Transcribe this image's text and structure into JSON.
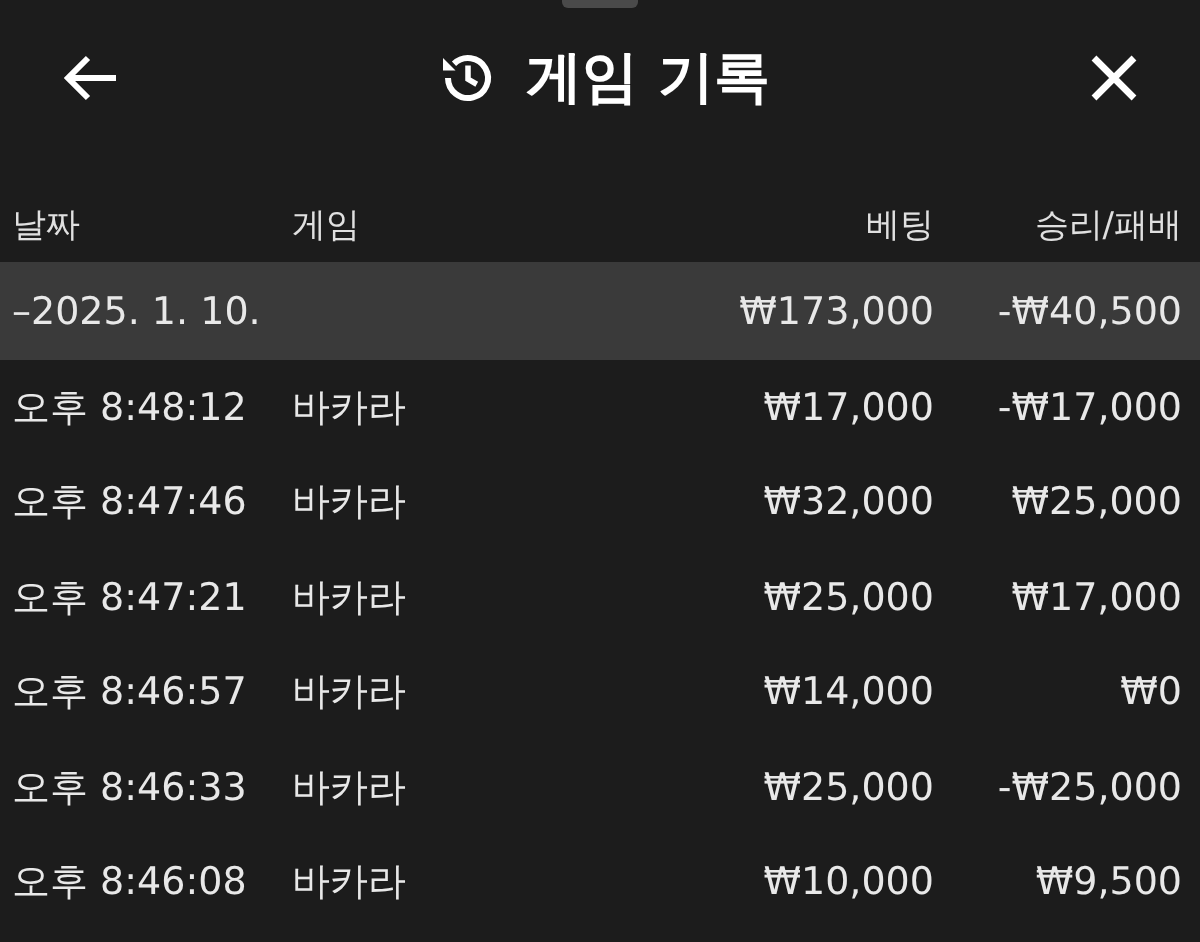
{
  "header": {
    "title": "게임 기록"
  },
  "table": {
    "columns": [
      "날짜",
      "게임",
      "베팅",
      "승리/패배"
    ],
    "group": {
      "label": "–2025. 1. 10.",
      "bet": "₩173,000",
      "result": "-₩40,500",
      "expanded": true
    },
    "rows": [
      {
        "time": "오후 8:48:12",
        "game": "바카라",
        "bet": "₩17,000",
        "result": "-₩17,000"
      },
      {
        "time": "오후 8:47:46",
        "game": "바카라",
        "bet": "₩32,000",
        "result": "₩25,000"
      },
      {
        "time": "오후 8:47:21",
        "game": "바카라",
        "bet": "₩25,000",
        "result": "₩17,000"
      },
      {
        "time": "오후 8:46:57",
        "game": "바카라",
        "bet": "₩14,000",
        "result": "₩0"
      },
      {
        "time": "오후 8:46:33",
        "game": "바카라",
        "bet": "₩25,000",
        "result": "-₩25,000"
      },
      {
        "time": "오후 8:46:08",
        "game": "바카라",
        "bet": "₩10,000",
        "result": "₩9,500"
      }
    ]
  }
}
